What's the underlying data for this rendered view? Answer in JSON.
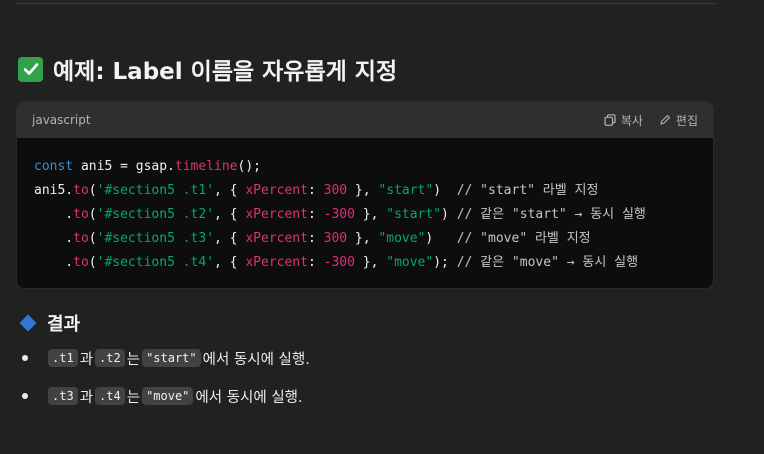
{
  "heading": {
    "text": "예제: Label 이름을 자유롭게 지정"
  },
  "code_block": {
    "language": "javascript",
    "copy_label": "복사",
    "edit_label": "편집",
    "lines": [
      [
        {
          "t": "kw",
          "v": "const"
        },
        {
          "t": "",
          "v": " ani5 = gsap."
        },
        {
          "t": "fn",
          "v": "timeline"
        },
        {
          "t": "",
          "v": "();"
        }
      ],
      [
        {
          "t": "",
          "v": "ani5."
        },
        {
          "t": "fn",
          "v": "to"
        },
        {
          "t": "",
          "v": "("
        },
        {
          "t": "str",
          "v": "'#section5 .t1'"
        },
        {
          "t": "",
          "v": ", { "
        },
        {
          "t": "prop",
          "v": "xPercent"
        },
        {
          "t": "",
          "v": ": "
        },
        {
          "t": "num",
          "v": "300"
        },
        {
          "t": "",
          "v": " }, "
        },
        {
          "t": "str",
          "v": "\"start\""
        },
        {
          "t": "",
          "v": ")  "
        },
        {
          "t": "cm",
          "v": "// \"start\" 라벨 지정"
        }
      ],
      [
        {
          "t": "",
          "v": "    ."
        },
        {
          "t": "fn",
          "v": "to"
        },
        {
          "t": "",
          "v": "("
        },
        {
          "t": "str",
          "v": "'#section5 .t2'"
        },
        {
          "t": "",
          "v": ", { "
        },
        {
          "t": "prop",
          "v": "xPercent"
        },
        {
          "t": "",
          "v": ": "
        },
        {
          "t": "num",
          "v": "-300"
        },
        {
          "t": "",
          "v": " }, "
        },
        {
          "t": "str",
          "v": "\"start\""
        },
        {
          "t": "",
          "v": ") "
        },
        {
          "t": "cm",
          "v": "// 같은 \"start\" → 동시 실행"
        }
      ],
      [
        {
          "t": "",
          "v": "    ."
        },
        {
          "t": "fn",
          "v": "to"
        },
        {
          "t": "",
          "v": "("
        },
        {
          "t": "str",
          "v": "'#section5 .t3'"
        },
        {
          "t": "",
          "v": ", { "
        },
        {
          "t": "prop",
          "v": "xPercent"
        },
        {
          "t": "",
          "v": ": "
        },
        {
          "t": "num",
          "v": "300"
        },
        {
          "t": "",
          "v": " }, "
        },
        {
          "t": "str",
          "v": "\"move\""
        },
        {
          "t": "",
          "v": ")   "
        },
        {
          "t": "cm",
          "v": "// \"move\" 라벨 지정"
        }
      ],
      [
        {
          "t": "",
          "v": "    ."
        },
        {
          "t": "fn",
          "v": "to"
        },
        {
          "t": "",
          "v": "("
        },
        {
          "t": "str",
          "v": "'#section5 .t4'"
        },
        {
          "t": "",
          "v": ", { "
        },
        {
          "t": "prop",
          "v": "xPercent"
        },
        {
          "t": "",
          "v": ": "
        },
        {
          "t": "num",
          "v": "-300"
        },
        {
          "t": "",
          "v": " }, "
        },
        {
          "t": "str",
          "v": "\"move\""
        },
        {
          "t": "",
          "v": "); "
        },
        {
          "t": "cm",
          "v": "// 같은 \"move\" → 동시 실행"
        }
      ]
    ]
  },
  "results": {
    "title": "결과",
    "items": [
      {
        "a": ".t1",
        "b": "과",
        "c": ".t2",
        "d": "는",
        "e": "\"start\"",
        "f": "에서 동시에 실행."
      },
      {
        "a": ".t3",
        "b": "과",
        "c": ".t4",
        "d": "는",
        "e": "\"move\"",
        "f": "에서 동시에 실행."
      }
    ]
  }
}
